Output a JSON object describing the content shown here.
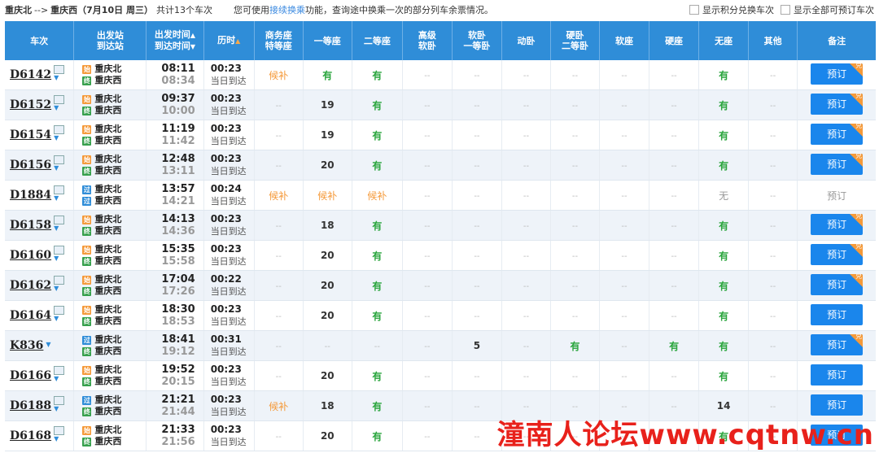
{
  "header": {
    "from": "重庆北",
    "arrow": "-->",
    "to": "重庆西",
    "date_text": "（7月10日 周三）",
    "count_text": "共计13个车次",
    "notice_prefix": "您可使用",
    "notice_link": "接续换乘",
    "notice_suffix": "功能，查询途中换乘一次的部分列车余票情况。",
    "opt_points": "显示积分兑换车次",
    "opt_all": "显示全部可预订车次"
  },
  "columns": {
    "train": "车次",
    "station_1": "出发站",
    "station_2": "到达站",
    "time_1": "出发时间",
    "time_2": "到达时间",
    "duration": "历时",
    "seat_business_1": "商务座",
    "seat_business_2": "特等座",
    "first": "一等座",
    "second": "二等座",
    "hisoft_1": "高级",
    "hisoft_2": "软卧",
    "softsleep_1": "软卧",
    "softsleep_2": "一等卧",
    "dongwo": "动卧",
    "hardsleep_1": "硬卧",
    "hardsleep_2": "二等卧",
    "softseat": "软座",
    "hardseat": "硬座",
    "noseat": "无座",
    "other": "其他",
    "remark": "备注"
  },
  "book_label": "预订",
  "corner_label": "兑",
  "rows": [
    {
      "train": "D6142",
      "from": "重庆北",
      "to": "重庆西",
      "from_badge": "始",
      "to_badge": "终",
      "from_type": "start",
      "dep": "08:11",
      "arr": "08:34",
      "dur": "00:23",
      "arr_day": "当日到达",
      "business": "候补",
      "first": "有",
      "second": "有",
      "hisoft": "--",
      "softsleep": "--",
      "dongwo": "--",
      "hardsleep": "--",
      "softseat": "--",
      "hardseat": "--",
      "noseat": "有",
      "other": "--",
      "bookable": true,
      "corner": true
    },
    {
      "train": "D6152",
      "from": "重庆北",
      "to": "重庆西",
      "from_badge": "始",
      "to_badge": "终",
      "from_type": "start",
      "dep": "09:37",
      "arr": "10:00",
      "dur": "00:23",
      "arr_day": "当日到达",
      "business": "--",
      "first": "19",
      "second": "有",
      "hisoft": "--",
      "softsleep": "--",
      "dongwo": "--",
      "hardsleep": "--",
      "softseat": "--",
      "hardseat": "--",
      "noseat": "有",
      "other": "--",
      "bookable": true,
      "corner": true
    },
    {
      "train": "D6154",
      "from": "重庆北",
      "to": "重庆西",
      "from_badge": "始",
      "to_badge": "终",
      "from_type": "start",
      "dep": "11:19",
      "arr": "11:42",
      "dur": "00:23",
      "arr_day": "当日到达",
      "business": "--",
      "first": "19",
      "second": "有",
      "hisoft": "--",
      "softsleep": "--",
      "dongwo": "--",
      "hardsleep": "--",
      "softseat": "--",
      "hardseat": "--",
      "noseat": "有",
      "other": "--",
      "bookable": true,
      "corner": true
    },
    {
      "train": "D6156",
      "from": "重庆北",
      "to": "重庆西",
      "from_badge": "始",
      "to_badge": "终",
      "from_type": "start",
      "dep": "12:48",
      "arr": "13:11",
      "dur": "00:23",
      "arr_day": "当日到达",
      "business": "--",
      "first": "20",
      "second": "有",
      "hisoft": "--",
      "softsleep": "--",
      "dongwo": "--",
      "hardsleep": "--",
      "softseat": "--",
      "hardseat": "--",
      "noseat": "有",
      "other": "--",
      "bookable": true,
      "corner": true
    },
    {
      "train": "D1884",
      "from": "重庆北",
      "to": "重庆西",
      "from_badge": "过",
      "to_badge": "过",
      "from_type": "pass",
      "to_type": "pass",
      "dep": "13:57",
      "arr": "14:21",
      "dur": "00:24",
      "arr_day": "当日到达",
      "business": "候补",
      "first": "候补",
      "second": "候补",
      "hisoft": "--",
      "softsleep": "--",
      "dongwo": "--",
      "hardsleep": "--",
      "softseat": "--",
      "hardseat": "--",
      "noseat": "无",
      "other": "--",
      "bookable": false,
      "corner": false
    },
    {
      "train": "D6158",
      "from": "重庆北",
      "to": "重庆西",
      "from_badge": "始",
      "to_badge": "终",
      "from_type": "start",
      "dep": "14:13",
      "arr": "14:36",
      "dur": "00:23",
      "arr_day": "当日到达",
      "business": "--",
      "first": "18",
      "second": "有",
      "hisoft": "--",
      "softsleep": "--",
      "dongwo": "--",
      "hardsleep": "--",
      "softseat": "--",
      "hardseat": "--",
      "noseat": "有",
      "other": "--",
      "bookable": true,
      "corner": true
    },
    {
      "train": "D6160",
      "from": "重庆北",
      "to": "重庆西",
      "from_badge": "始",
      "to_badge": "终",
      "from_type": "start",
      "dep": "15:35",
      "arr": "15:58",
      "dur": "00:23",
      "arr_day": "当日到达",
      "business": "--",
      "first": "20",
      "second": "有",
      "hisoft": "--",
      "softsleep": "--",
      "dongwo": "--",
      "hardsleep": "--",
      "softseat": "--",
      "hardseat": "--",
      "noseat": "有",
      "other": "--",
      "bookable": true,
      "corner": true
    },
    {
      "train": "D6162",
      "from": "重庆北",
      "to": "重庆西",
      "from_badge": "始",
      "to_badge": "终",
      "from_type": "start",
      "dep": "17:04",
      "arr": "17:26",
      "dur": "00:22",
      "arr_day": "当日到达",
      "business": "--",
      "first": "20",
      "second": "有",
      "hisoft": "--",
      "softsleep": "--",
      "dongwo": "--",
      "hardsleep": "--",
      "softseat": "--",
      "hardseat": "--",
      "noseat": "有",
      "other": "--",
      "bookable": true,
      "corner": true
    },
    {
      "train": "D6164",
      "from": "重庆北",
      "to": "重庆西",
      "from_badge": "始",
      "to_badge": "终",
      "from_type": "start",
      "dep": "18:30",
      "arr": "18:53",
      "dur": "00:23",
      "arr_day": "当日到达",
      "business": "--",
      "first": "20",
      "second": "有",
      "hisoft": "--",
      "softsleep": "--",
      "dongwo": "--",
      "hardsleep": "--",
      "softseat": "--",
      "hardseat": "--",
      "noseat": "有",
      "other": "--",
      "bookable": true,
      "corner": false
    },
    {
      "train": "K836",
      "from": "重庆北",
      "to": "重庆西",
      "from_badge": "过",
      "to_badge": "终",
      "from_type": "pass",
      "dep": "18:41",
      "arr": "19:12",
      "dur": "00:31",
      "arr_day": "当日到达",
      "business": "--",
      "first": "--",
      "second": "--",
      "hisoft": "--",
      "softsleep": "5",
      "dongwo": "--",
      "hardsleep": "有",
      "softseat": "--",
      "hardseat": "有",
      "noseat": "有",
      "other": "--",
      "bookable": true,
      "corner": true
    },
    {
      "train": "D6166",
      "from": "重庆北",
      "to": "重庆西",
      "from_badge": "始",
      "to_badge": "终",
      "from_type": "start",
      "dep": "19:52",
      "arr": "20:15",
      "dur": "00:23",
      "arr_day": "当日到达",
      "business": "--",
      "first": "20",
      "second": "有",
      "hisoft": "--",
      "softsleep": "--",
      "dongwo": "--",
      "hardsleep": "--",
      "softseat": "--",
      "hardseat": "--",
      "noseat": "有",
      "other": "--",
      "bookable": true,
      "corner": false
    },
    {
      "train": "D6188",
      "from": "重庆北",
      "to": "重庆西",
      "from_badge": "过",
      "to_badge": "终",
      "from_type": "pass",
      "dep": "21:21",
      "arr": "21:44",
      "dur": "00:23",
      "arr_day": "当日到达",
      "business": "候补",
      "first": "18",
      "second": "有",
      "hisoft": "--",
      "softsleep": "--",
      "dongwo": "--",
      "hardsleep": "--",
      "softseat": "--",
      "hardseat": "--",
      "noseat": "14",
      "other": "--",
      "bookable": true,
      "corner": false
    },
    {
      "train": "D6168",
      "from": "重庆北",
      "to": "重庆西",
      "from_badge": "始",
      "to_badge": "终",
      "from_type": "start",
      "dep": "21:33",
      "arr": "21:56",
      "dur": "00:23",
      "arr_day": "当日到达",
      "business": "--",
      "first": "20",
      "second": "有",
      "hisoft": "--",
      "softsleep": "--",
      "dongwo": "--",
      "hardsleep": "--",
      "softseat": "--",
      "hardseat": "--",
      "noseat": "有",
      "other": "--",
      "bookable": true,
      "corner": false
    }
  ],
  "watermark": "潼南人论坛www.cqtnw.cn",
  "colors": {
    "header_bg": "#2f8dd8",
    "has": "#2aa53d",
    "wait": "#f59a3a",
    "book": "#1a86ec"
  }
}
